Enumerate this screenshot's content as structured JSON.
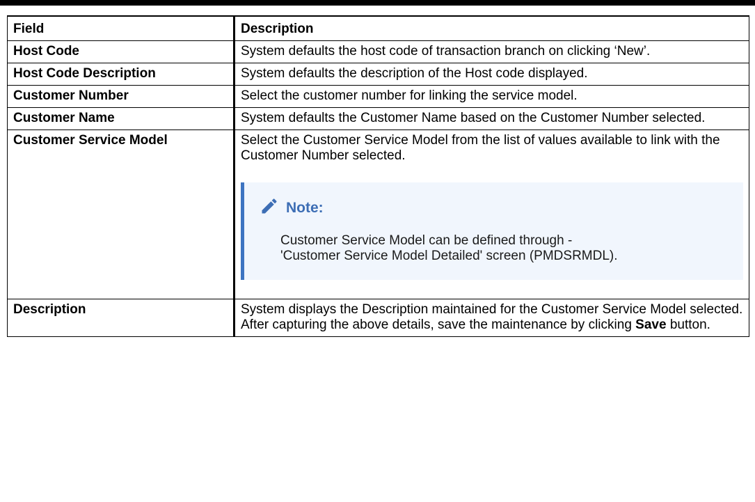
{
  "table": {
    "headers": {
      "field": "Field",
      "description": "Description"
    },
    "rows": [
      {
        "field": "Host Code",
        "description": "System defaults the host code of transaction branch on clicking ‘New’."
      },
      {
        "field": "Host Code Description",
        "description": "System defaults the description of the Host code displayed."
      },
      {
        "field": "Customer Number",
        "description": "Select the customer number for linking the service model."
      },
      {
        "field": "Customer Name",
        "description": "System defaults the Customer Name based on the Customer Number selected."
      },
      {
        "field": "Customer Service Model",
        "description": "Select the Customer Service Model from the list of values available to link with the Customer Number selected.",
        "note": {
          "title": "Note:",
          "line1": "Customer Service Model can be defined through -",
          "line2": "'Customer Service Model Detailed' screen (PMDSRMDL)."
        }
      },
      {
        "field": "Description",
        "description": "System displays the Description maintained for the Customer Service Model selected.",
        "description_2": "After capturing the above details, save the maintenance by clicking",
        "bold_word": "Save",
        "suffix": " button."
      }
    ]
  },
  "colors": {
    "note_accent": "#3d74c1",
    "note_bg": "#f1f6fd",
    "note_title": "#3d6eb5"
  },
  "icons": {
    "note": "pencil-icon"
  }
}
